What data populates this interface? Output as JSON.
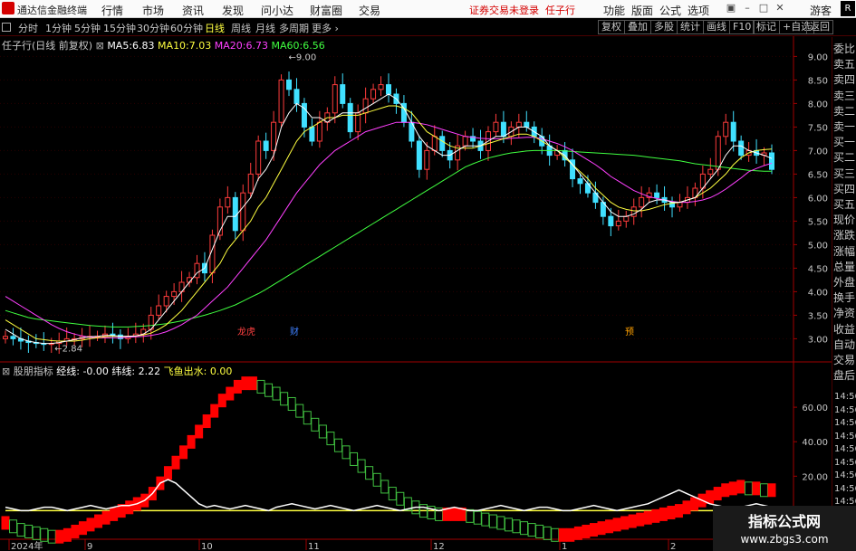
{
  "window": {
    "app_title": "通达信金融终端",
    "menus": [
      "行情",
      "市场",
      "资讯",
      "发现",
      "问小达",
      "财富圈",
      "交易"
    ],
    "notice": "证券交易未登录",
    "stock_name_top": "任子行",
    "right_menus": [
      "功能",
      "版面",
      "公式",
      "选项"
    ],
    "guest": "游客",
    "corner_logo": "R"
  },
  "toolbar": {
    "periods": [
      "分时",
      "1分钟",
      "5分钟",
      "15分钟",
      "30分钟",
      "60分钟",
      "日线",
      "周线",
      "月线",
      "多周期",
      "更多"
    ],
    "active_period": "日线",
    "right_buttons": [
      "复权",
      "叠加",
      "多股",
      "统计",
      "画线",
      "F10",
      "标记",
      "+自选",
      "返回"
    ]
  },
  "main_chart": {
    "title": "任子行(日线 前复权)",
    "ma": [
      {
        "label": "MA5:",
        "value": "6.83",
        "color": "#ffffff"
      },
      {
        "label": "MA10:",
        "value": "7.03",
        "color": "#ffff40"
      },
      {
        "label": "MA20:",
        "value": "6.73",
        "color": "#ff40ff"
      },
      {
        "label": "MA60:",
        "value": "6.56",
        "color": "#40ff40"
      }
    ],
    "high_label": "9.00",
    "low_label": "2.84",
    "events": [
      "龙虎",
      "财",
      "预"
    ]
  },
  "sub_chart": {
    "name": "股朋指标",
    "items": [
      {
        "label": "经线:",
        "value": "-0.00",
        "color": "#ffffff"
      },
      {
        "label": "纬线:",
        "value": "2.22",
        "color": "#ffffff"
      },
      {
        "label": "飞鱼出水:",
        "value": "0.00",
        "color": "#ffff40"
      }
    ]
  },
  "chart_data": [
    {
      "type": "candlestick",
      "title": "任子行(日线 前复权)",
      "y_ticks": [
        "9.00",
        "8.50",
        "8.00",
        "7.50",
        "7.00",
        "6.50",
        "6.00",
        "5.50",
        "5.00",
        "4.50",
        "4.00",
        "3.50",
        "3.00"
      ],
      "ylim": [
        2.7,
        9.2
      ],
      "high": 9.0,
      "low": 2.84,
      "closes": [
        3.05,
        3.0,
        2.95,
        2.92,
        2.9,
        2.88,
        2.9,
        2.95,
        3.0,
        3.0,
        3.05,
        3.05,
        3.05,
        3.1,
        3.08,
        3.0,
        3.05,
        3.1,
        3.2,
        3.5,
        3.7,
        3.9,
        4.0,
        4.2,
        4.3,
        4.6,
        4.4,
        5.2,
        5.8,
        6.0,
        5.3,
        6.1,
        6.5,
        7.2,
        7.0,
        7.6,
        8.5,
        8.3,
        8.0,
        7.5,
        7.2,
        7.6,
        7.8,
        8.4,
        8.0,
        7.4,
        7.8,
        8.1,
        8.3,
        8.4,
        8.2,
        8.0,
        7.6,
        7.2,
        6.6,
        7.0,
        7.3,
        7.0,
        6.8,
        7.1,
        7.3,
        7.2,
        7.0,
        7.4,
        7.6,
        7.3,
        7.5,
        7.6,
        7.5,
        7.3,
        7.1,
        6.9,
        7.0,
        6.8,
        6.4,
        6.3,
        6.1,
        5.9,
        5.6,
        5.4,
        5.5,
        5.6,
        5.8,
        6.0,
        6.1,
        6.0,
        5.9,
        5.8,
        5.9,
        6.0,
        6.2,
        6.5,
        6.6,
        7.3,
        7.6,
        7.2,
        6.9,
        7.0,
        6.9,
        6.95,
        6.6
      ],
      "ma5": [
        3.2,
        3.1,
        3.0,
        2.95,
        2.92,
        2.9,
        2.9,
        2.92,
        2.95,
        2.98,
        3.02,
        3.04,
        3.05,
        3.07,
        3.07,
        3.05,
        3.05,
        3.06,
        3.1,
        3.2,
        3.4,
        3.6,
        3.8,
        4.0,
        4.2,
        4.4,
        4.5,
        4.9,
        5.3,
        5.6,
        5.6,
        5.8,
        6.0,
        6.4,
        6.6,
        6.9,
        7.5,
        7.8,
        8.0,
        7.9,
        7.7,
        7.7,
        7.6,
        7.7,
        7.8,
        7.8,
        7.8,
        7.9,
        8.0,
        8.1,
        8.2,
        8.1,
        7.9,
        7.6,
        7.3,
        7.1,
        7.0,
        6.9,
        6.9,
        7.0,
        7.1,
        7.1,
        7.1,
        7.2,
        7.3,
        7.3,
        7.4,
        7.5,
        7.5,
        7.4,
        7.3,
        7.1,
        7.0,
        6.9,
        6.7,
        6.5,
        6.3,
        6.1,
        5.9,
        5.7,
        5.6,
        5.6,
        5.65,
        5.75,
        5.9,
        5.95,
        5.95,
        5.9,
        5.9,
        5.95,
        6.0,
        6.2,
        6.4,
        6.6,
        6.9,
        7.1,
        7.1,
        7.0,
        6.95,
        6.9,
        6.83
      ],
      "ma10": [
        3.4,
        3.3,
        3.2,
        3.1,
        3.0,
        2.98,
        2.96,
        2.95,
        2.95,
        2.95,
        2.97,
        3.0,
        3.02,
        3.04,
        3.05,
        3.05,
        3.05,
        3.06,
        3.08,
        3.12,
        3.2,
        3.3,
        3.45,
        3.6,
        3.8,
        4.0,
        4.2,
        4.4,
        4.6,
        4.9,
        5.1,
        5.3,
        5.5,
        5.8,
        6.0,
        6.3,
        6.6,
        6.9,
        7.2,
        7.4,
        7.5,
        7.6,
        7.7,
        7.7,
        7.75,
        7.75,
        7.75,
        7.8,
        7.85,
        7.9,
        7.95,
        7.95,
        7.9,
        7.8,
        7.6,
        7.4,
        7.3,
        7.2,
        7.1,
        7.05,
        7.05,
        7.05,
        7.1,
        7.15,
        7.2,
        7.25,
        7.3,
        7.35,
        7.35,
        7.3,
        7.2,
        7.1,
        7.0,
        6.85,
        6.7,
        6.55,
        6.4,
        6.2,
        6.05,
        5.9,
        5.8,
        5.75,
        5.72,
        5.72,
        5.75,
        5.8,
        5.85,
        5.88,
        5.9,
        5.95,
        6.0,
        6.1,
        6.2,
        6.35,
        6.5,
        6.7,
        6.85,
        6.95,
        7.0,
        7.02,
        7.03
      ],
      "ma20": [
        3.9,
        3.8,
        3.7,
        3.6,
        3.5,
        3.4,
        3.3,
        3.22,
        3.15,
        3.1,
        3.06,
        3.03,
        3.02,
        3.02,
        3.02,
        3.02,
        3.03,
        3.04,
        3.05,
        3.07,
        3.1,
        3.15,
        3.22,
        3.3,
        3.4,
        3.5,
        3.65,
        3.8,
        3.95,
        4.1,
        4.3,
        4.5,
        4.7,
        4.9,
        5.1,
        5.35,
        5.6,
        5.85,
        6.1,
        6.3,
        6.5,
        6.7,
        6.85,
        7.0,
        7.1,
        7.2,
        7.3,
        7.4,
        7.45,
        7.5,
        7.55,
        7.6,
        7.6,
        7.6,
        7.58,
        7.55,
        7.5,
        7.45,
        7.4,
        7.35,
        7.3,
        7.28,
        7.26,
        7.25,
        7.25,
        7.25,
        7.26,
        7.27,
        7.28,
        7.28,
        7.25,
        7.2,
        7.15,
        7.08,
        7.0,
        6.9,
        6.8,
        6.7,
        6.58,
        6.45,
        6.35,
        6.25,
        6.15,
        6.08,
        6.02,
        5.98,
        5.95,
        5.92,
        5.9,
        5.9,
        5.92,
        5.95,
        6.0,
        6.08,
        6.18,
        6.3,
        6.42,
        6.55,
        6.62,
        6.68,
        6.73
      ],
      "ma60": [
        3.6,
        3.55,
        3.5,
        3.45,
        3.42,
        3.4,
        3.38,
        3.36,
        3.34,
        3.32,
        3.3,
        3.28,
        3.27,
        3.26,
        3.25,
        3.25,
        3.25,
        3.26,
        3.27,
        3.28,
        3.3,
        3.32,
        3.35,
        3.38,
        3.42,
        3.46,
        3.5,
        3.55,
        3.6,
        3.66,
        3.72,
        3.8,
        3.88,
        3.96,
        4.05,
        4.15,
        4.25,
        4.35,
        4.45,
        4.55,
        4.65,
        4.75,
        4.85,
        4.95,
        5.05,
        5.15,
        5.25,
        5.35,
        5.45,
        5.55,
        5.65,
        5.75,
        5.85,
        5.95,
        6.05,
        6.15,
        6.25,
        6.35,
        6.45,
        6.55,
        6.65,
        6.72,
        6.78,
        6.84,
        6.88,
        6.92,
        6.95,
        6.97,
        6.99,
        7.0,
        7.0,
        7.0,
        7.0,
        6.99,
        6.98,
        6.97,
        6.96,
        6.95,
        6.94,
        6.93,
        6.92,
        6.91,
        6.9,
        6.88,
        6.86,
        6.84,
        6.82,
        6.8,
        6.78,
        6.75,
        6.72,
        6.7,
        6.68,
        6.66,
        6.64,
        6.62,
        6.6,
        6.58,
        6.57,
        6.56,
        6.56
      ]
    },
    {
      "type": "area",
      "title": "股朋指标",
      "y_ticks": [
        "60.00",
        "40.00",
        "20.00",
        "0.00"
      ],
      "ylim": [
        -15,
        80
      ],
      "jingxian": [
        -5,
        -7,
        -9,
        -10,
        -11,
        -12,
        -13,
        -13,
        -12,
        -10,
        -8,
        -6,
        -4,
        -2,
        0,
        2,
        4,
        6,
        8,
        12,
        18,
        24,
        30,
        36,
        42,
        48,
        54,
        60,
        66,
        70,
        74,
        76,
        76,
        74,
        72,
        70,
        67,
        64,
        60,
        56,
        52,
        48,
        44,
        40,
        36,
        32,
        28,
        24,
        20,
        16,
        12,
        9,
        6,
        4,
        2,
        1,
        0,
        0,
        0,
        0,
        -1,
        -2,
        -3,
        -4,
        -5,
        -6,
        -7,
        -8,
        -9,
        -10,
        -11,
        -12,
        -12,
        -12,
        -11,
        -10,
        -9,
        -8,
        -7,
        -6,
        -5,
        -4,
        -3,
        -2,
        -1,
        0,
        1,
        2,
        4,
        6,
        8,
        10,
        12,
        14,
        15,
        16,
        15,
        15,
        14,
        14
      ],
      "weixian": [
        2,
        1,
        0,
        0,
        1,
        2,
        2,
        1,
        0,
        1,
        2,
        3,
        2,
        1,
        2,
        3,
        3,
        4,
        6,
        10,
        16,
        18,
        16,
        12,
        8,
        4,
        2,
        3,
        2,
        1,
        2,
        3,
        2,
        1,
        0,
        2,
        3,
        4,
        3,
        2,
        1,
        2,
        3,
        2,
        1,
        0,
        1,
        2,
        3,
        2,
        1,
        0,
        1,
        2,
        2,
        1,
        0,
        1,
        2,
        1,
        0,
        0,
        1,
        2,
        3,
        2,
        1,
        0,
        1,
        2,
        2,
        1,
        0,
        0,
        1,
        2,
        3,
        2,
        1,
        0,
        1,
        2,
        3,
        4,
        6,
        8,
        10,
        12,
        10,
        8,
        6,
        4,
        3,
        2,
        1,
        2,
        3,
        4,
        3,
        2,
        2
      ],
      "feiyu": [
        0,
        0,
        0,
        0,
        0,
        0,
        0,
        0,
        0,
        0,
        0,
        0,
        0,
        0,
        0,
        0,
        0,
        0,
        0,
        0,
        0,
        0,
        0,
        0,
        0,
        0,
        0,
        0,
        0,
        0,
        0,
        0,
        0,
        0,
        0,
        0,
        0,
        0,
        0,
        0,
        0,
        0,
        0,
        0,
        0,
        0,
        0,
        0,
        0,
        0,
        0,
        0,
        0,
        0,
        0,
        0,
        0,
        0,
        0,
        0,
        0,
        0,
        0,
        0,
        0,
        0,
        0,
        0,
        0,
        0,
        0,
        0,
        0,
        0,
        0,
        0,
        0,
        0,
        0,
        0,
        0,
        0,
        0,
        0,
        0,
        0,
        0,
        0,
        0,
        0,
        0,
        0,
        0,
        0,
        0,
        0,
        0,
        0,
        0,
        0,
        0
      ]
    }
  ],
  "x_axis": {
    "labels": [
      "2024年",
      "9",
      "10",
      "11",
      "12",
      "1",
      "2"
    ]
  },
  "right_panel": {
    "labels": [
      "委比",
      "卖五",
      "卖四",
      "卖三",
      "卖二",
      "卖一",
      "买一",
      "买二",
      "买三",
      "买四",
      "买五",
      "现价",
      "涨跌",
      "涨幅",
      "总量",
      "外盘",
      "换手",
      "净资",
      "收益",
      "自动",
      "交易",
      "盘后"
    ],
    "times": [
      "14:56",
      "14:56",
      "14:56",
      "14:56",
      "14:56",
      "14:56",
      "14:56",
      "14:56",
      "14:56",
      "14:56"
    ]
  },
  "watermark": {
    "line1": "指标公式网",
    "line2": "www.zbgs3.com"
  },
  "colors": {
    "up": "#ff3c3c",
    "down": "#40e0ff",
    "axis_red": "#a00000",
    "jingxian_up": "#ff0000",
    "jingxian_down": "#40c040",
    "weixian": "#ffffff",
    "feiyu": "#ffff40"
  }
}
